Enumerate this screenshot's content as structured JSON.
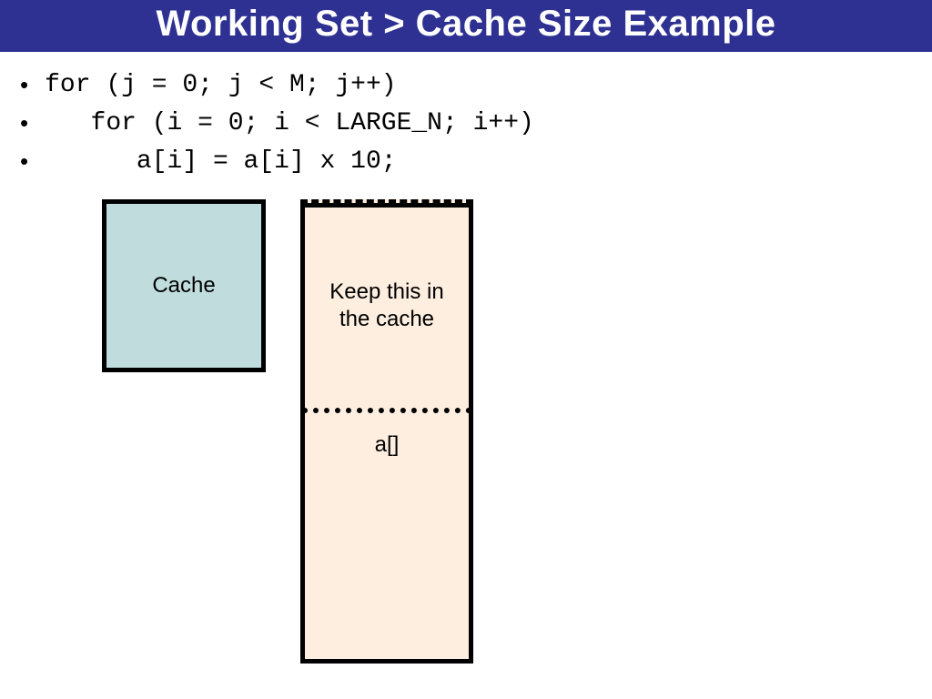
{
  "title": "Working Set > Cache Size Example",
  "code": {
    "line1": "for (j = 0; j < M; j++)",
    "line2": "   for (i = 0; i < LARGE_N; i++)",
    "line3": "      a[i] = a[i] x 10;"
  },
  "diagram": {
    "cache_label": "Cache",
    "array_top_text": "Keep this in the cache",
    "array_bottom_label": "a[]"
  },
  "colors": {
    "title_bg": "#2e3192",
    "cache_fill": "#c0dcdc",
    "array_fill": "#fdeee0"
  }
}
